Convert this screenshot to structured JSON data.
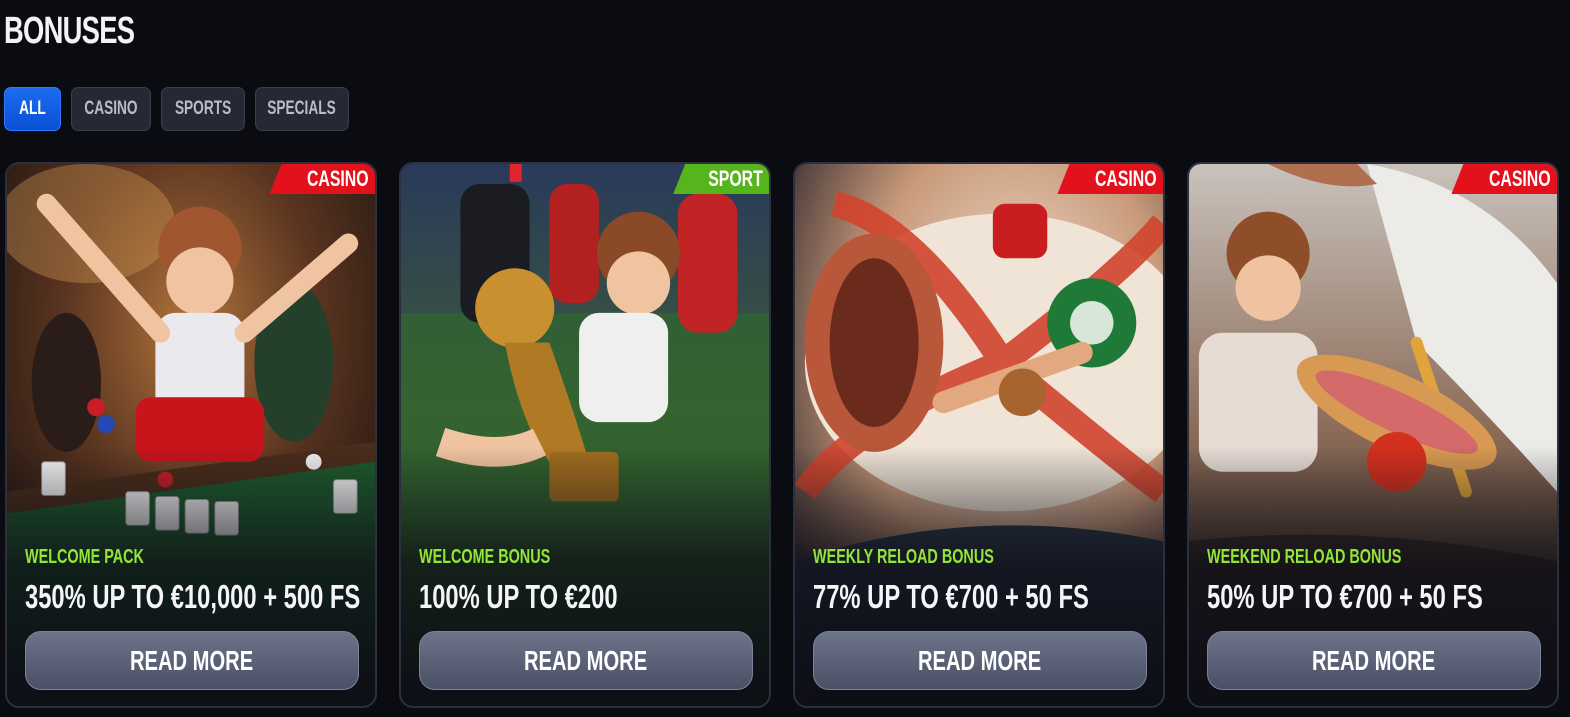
{
  "page": {
    "title": "BONUSES"
  },
  "filters": [
    {
      "label": "ALL",
      "active": true
    },
    {
      "label": "CASINO",
      "active": false
    },
    {
      "label": "SPORTS",
      "active": false
    },
    {
      "label": "SPECIALS",
      "active": false
    }
  ],
  "cards": [
    {
      "tag": "CASINO",
      "tag_type": "casino",
      "kind": "WELCOME PACK",
      "offer": "350% UP TO €10,000 + 500 FS",
      "button": "READ MORE",
      "art": "casino-celebration-illustration"
    },
    {
      "tag": "SPORT",
      "tag_type": "sport",
      "kind": "WELCOME BONUS",
      "offer": "100% UP TO €200",
      "button": "READ MORE",
      "art": "football-trophy-illustration"
    },
    {
      "tag": "CASINO",
      "tag_type": "casino",
      "kind": "WEEKLY RELOAD BONUS",
      "offer": "77% UP TO €700 + 50 FS",
      "button": "READ MORE",
      "art": "water-slide-illustration"
    },
    {
      "tag": "CASINO",
      "tag_type": "casino",
      "kind": "WEEKEND RELOAD BONUS",
      "offer": "50% UP TO €700 + 50 FS",
      "button": "READ MORE",
      "art": "seagull-sandwich-illustration"
    }
  ],
  "colors": {
    "accent": "#1d6cf0",
    "casino_tag": "#e3111c",
    "sport_tag": "#56b51c",
    "kind_text": "#94e53a"
  }
}
